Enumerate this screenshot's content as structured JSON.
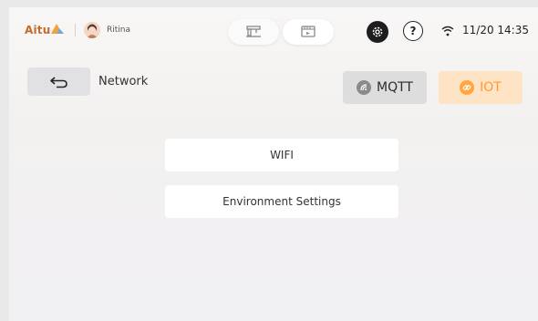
{
  "status": {
    "logo_text": "Aitu",
    "user_name": "Ritina",
    "time": "11/20 14:35",
    "icons": [
      "logo-mark-icon",
      "avatar",
      "sewing-machine-icon",
      "screen-monitor-icon",
      "gear-icon",
      "help-icon",
      "wifi-icon"
    ]
  },
  "header": {
    "back_icon": "return-arrow-icon",
    "title": "Network"
  },
  "tabs": [
    {
      "label": "MQTT",
      "icon": "mqtt-icon",
      "active": false
    },
    {
      "label": "IOT",
      "icon": "link-icon",
      "active": true
    }
  ],
  "menu": [
    {
      "label": "WIFI"
    },
    {
      "label": "Environment Settings"
    }
  ],
  "colors": {
    "accent": "#ff9a2d",
    "accent_bg": "#ffe3c5",
    "logo": "#c56a2e",
    "inactive_tab_bg": "#dedddd"
  }
}
